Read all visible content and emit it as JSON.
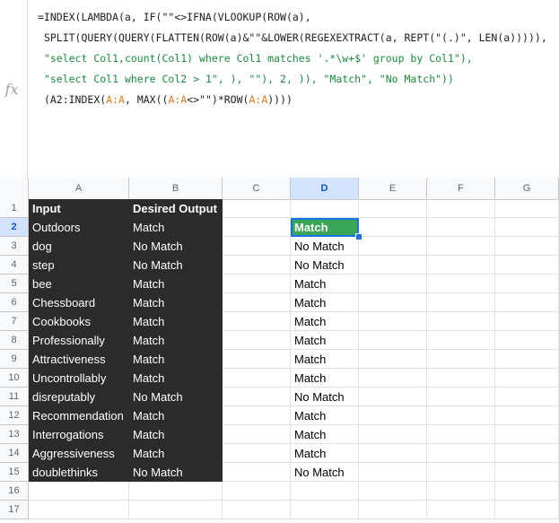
{
  "formula": {
    "fx_label": "fx",
    "lines": [
      [
        {
          "t": "=INDEX(LAMBDA(a, IF(\"\"<>IFNA(VLOOKUP(ROW(a),",
          "c": ""
        }
      ],
      [
        {
          "t": "SPLIT(QUERY(QUERY(FLATTEN(ROW(a)&\"\"&LOWER(REGEXEXTRACT(a, REPT(\"(.)\", LEN(a))))),",
          "c": ""
        }
      ],
      [
        {
          "t": "\"select Col1,count(Col1) where Col1 matches '.*\\w+$' group by Col1\"),",
          "c": "str"
        }
      ],
      [
        {
          "t": "\"select Col1 where Col2 > 1\", ), \"\"), 2, )), \"Match\", \"No Match\"))",
          "c": "str"
        }
      ],
      [
        {
          "t": "(A2:INDEX(",
          "c": ""
        },
        {
          "t": "A:A",
          "c": "ref"
        },
        {
          "t": ", MAX((",
          "c": ""
        },
        {
          "t": "A:A",
          "c": "ref"
        },
        {
          "t": "<>\"\")*ROW(",
          "c": ""
        },
        {
          "t": "A:A",
          "c": "ref"
        },
        {
          "t": "))))",
          "c": ""
        }
      ]
    ]
  },
  "columns": [
    "A",
    "B",
    "C",
    "D",
    "E",
    "F",
    "G"
  ],
  "selected_column": "D",
  "selected_row": 2,
  "rows": [
    {
      "num": "1",
      "a": "Input",
      "b": "Desired Output",
      "d": ""
    },
    {
      "num": "2",
      "a": "Outdoors",
      "b": "Match",
      "d": "Match"
    },
    {
      "num": "3",
      "a": "dog",
      "b": "No Match",
      "d": "No Match"
    },
    {
      "num": "4",
      "a": "step",
      "b": "No Match",
      "d": "No Match"
    },
    {
      "num": "5",
      "a": "bee",
      "b": "Match",
      "d": "Match"
    },
    {
      "num": "6",
      "a": "Chessboard",
      "b": "Match",
      "d": "Match"
    },
    {
      "num": "7",
      "a": "Cookbooks",
      "b": "Match",
      "d": "Match"
    },
    {
      "num": "8",
      "a": "Professionally",
      "b": "Match",
      "d": "Match"
    },
    {
      "num": "9",
      "a": "Attractiveness",
      "b": "Match",
      "d": "Match"
    },
    {
      "num": "10",
      "a": "Uncontrollably",
      "b": "Match",
      "d": "Match"
    },
    {
      "num": "11",
      "a": "disreputably",
      "b": "No Match",
      "d": "No Match"
    },
    {
      "num": "12",
      "a": "Recommendation",
      "b": "Match",
      "d": "Match"
    },
    {
      "num": "13",
      "a": "Interrogations",
      "b": "Match",
      "d": "Match"
    },
    {
      "num": "14",
      "a": "Aggressiveness",
      "b": "Match",
      "d": "Match"
    },
    {
      "num": "15",
      "a": "doublethinks",
      "b": "No Match",
      "d": "No Match"
    },
    {
      "num": "16",
      "a": "",
      "b": "",
      "d": ""
    },
    {
      "num": "17",
      "a": "",
      "b": "",
      "d": ""
    }
  ],
  "colors": {
    "dark_fill": "#2b2b2b",
    "active_fill": "#3aa655",
    "selection_blue": "#1a73e8"
  }
}
